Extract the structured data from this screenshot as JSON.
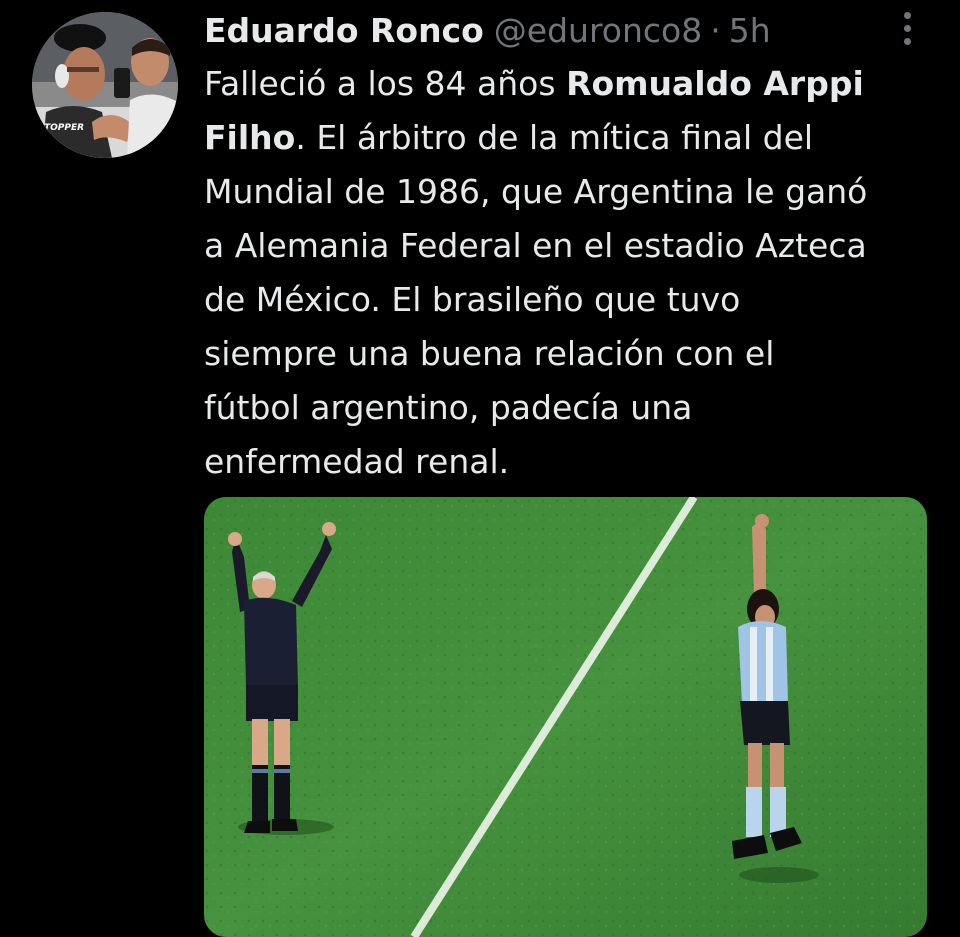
{
  "tweet": {
    "author": {
      "display_name": "Eduardo Ronco",
      "handle": "@eduronco8"
    },
    "separator": "·",
    "time": "5h",
    "more_icon": "more-vertical-icon",
    "text_lines": [
      {
        "before": "Falleció a los 84 años ",
        "bold": "Romualdo Arppi",
        "after": ""
      },
      {
        "before": "",
        "bold": "Filho",
        "after": ". El árbitro de la mítica final del"
      },
      {
        "before": "Mundial de 1986, que Argentina le ganó",
        "bold": "",
        "after": ""
      },
      {
        "before": "a Alemania Federal en el estadio Azteca",
        "bold": "",
        "after": ""
      },
      {
        "before": "de México. El brasileño que tuvo",
        "bold": "",
        "after": ""
      },
      {
        "before": "siempre una buena relación con el",
        "bold": "",
        "after": ""
      },
      {
        "before": "fútbol argentino, padecía una",
        "bold": "",
        "after": ""
      },
      {
        "before": "enfermedad renal.",
        "bold": "",
        "after": ""
      }
    ],
    "avatar_logo_text": "TOPPER"
  },
  "colors": {
    "background": "#000000",
    "primary_text": "#e7e9ea",
    "secondary_text": "#71767b",
    "pitch_green": "#3f8a3a"
  }
}
